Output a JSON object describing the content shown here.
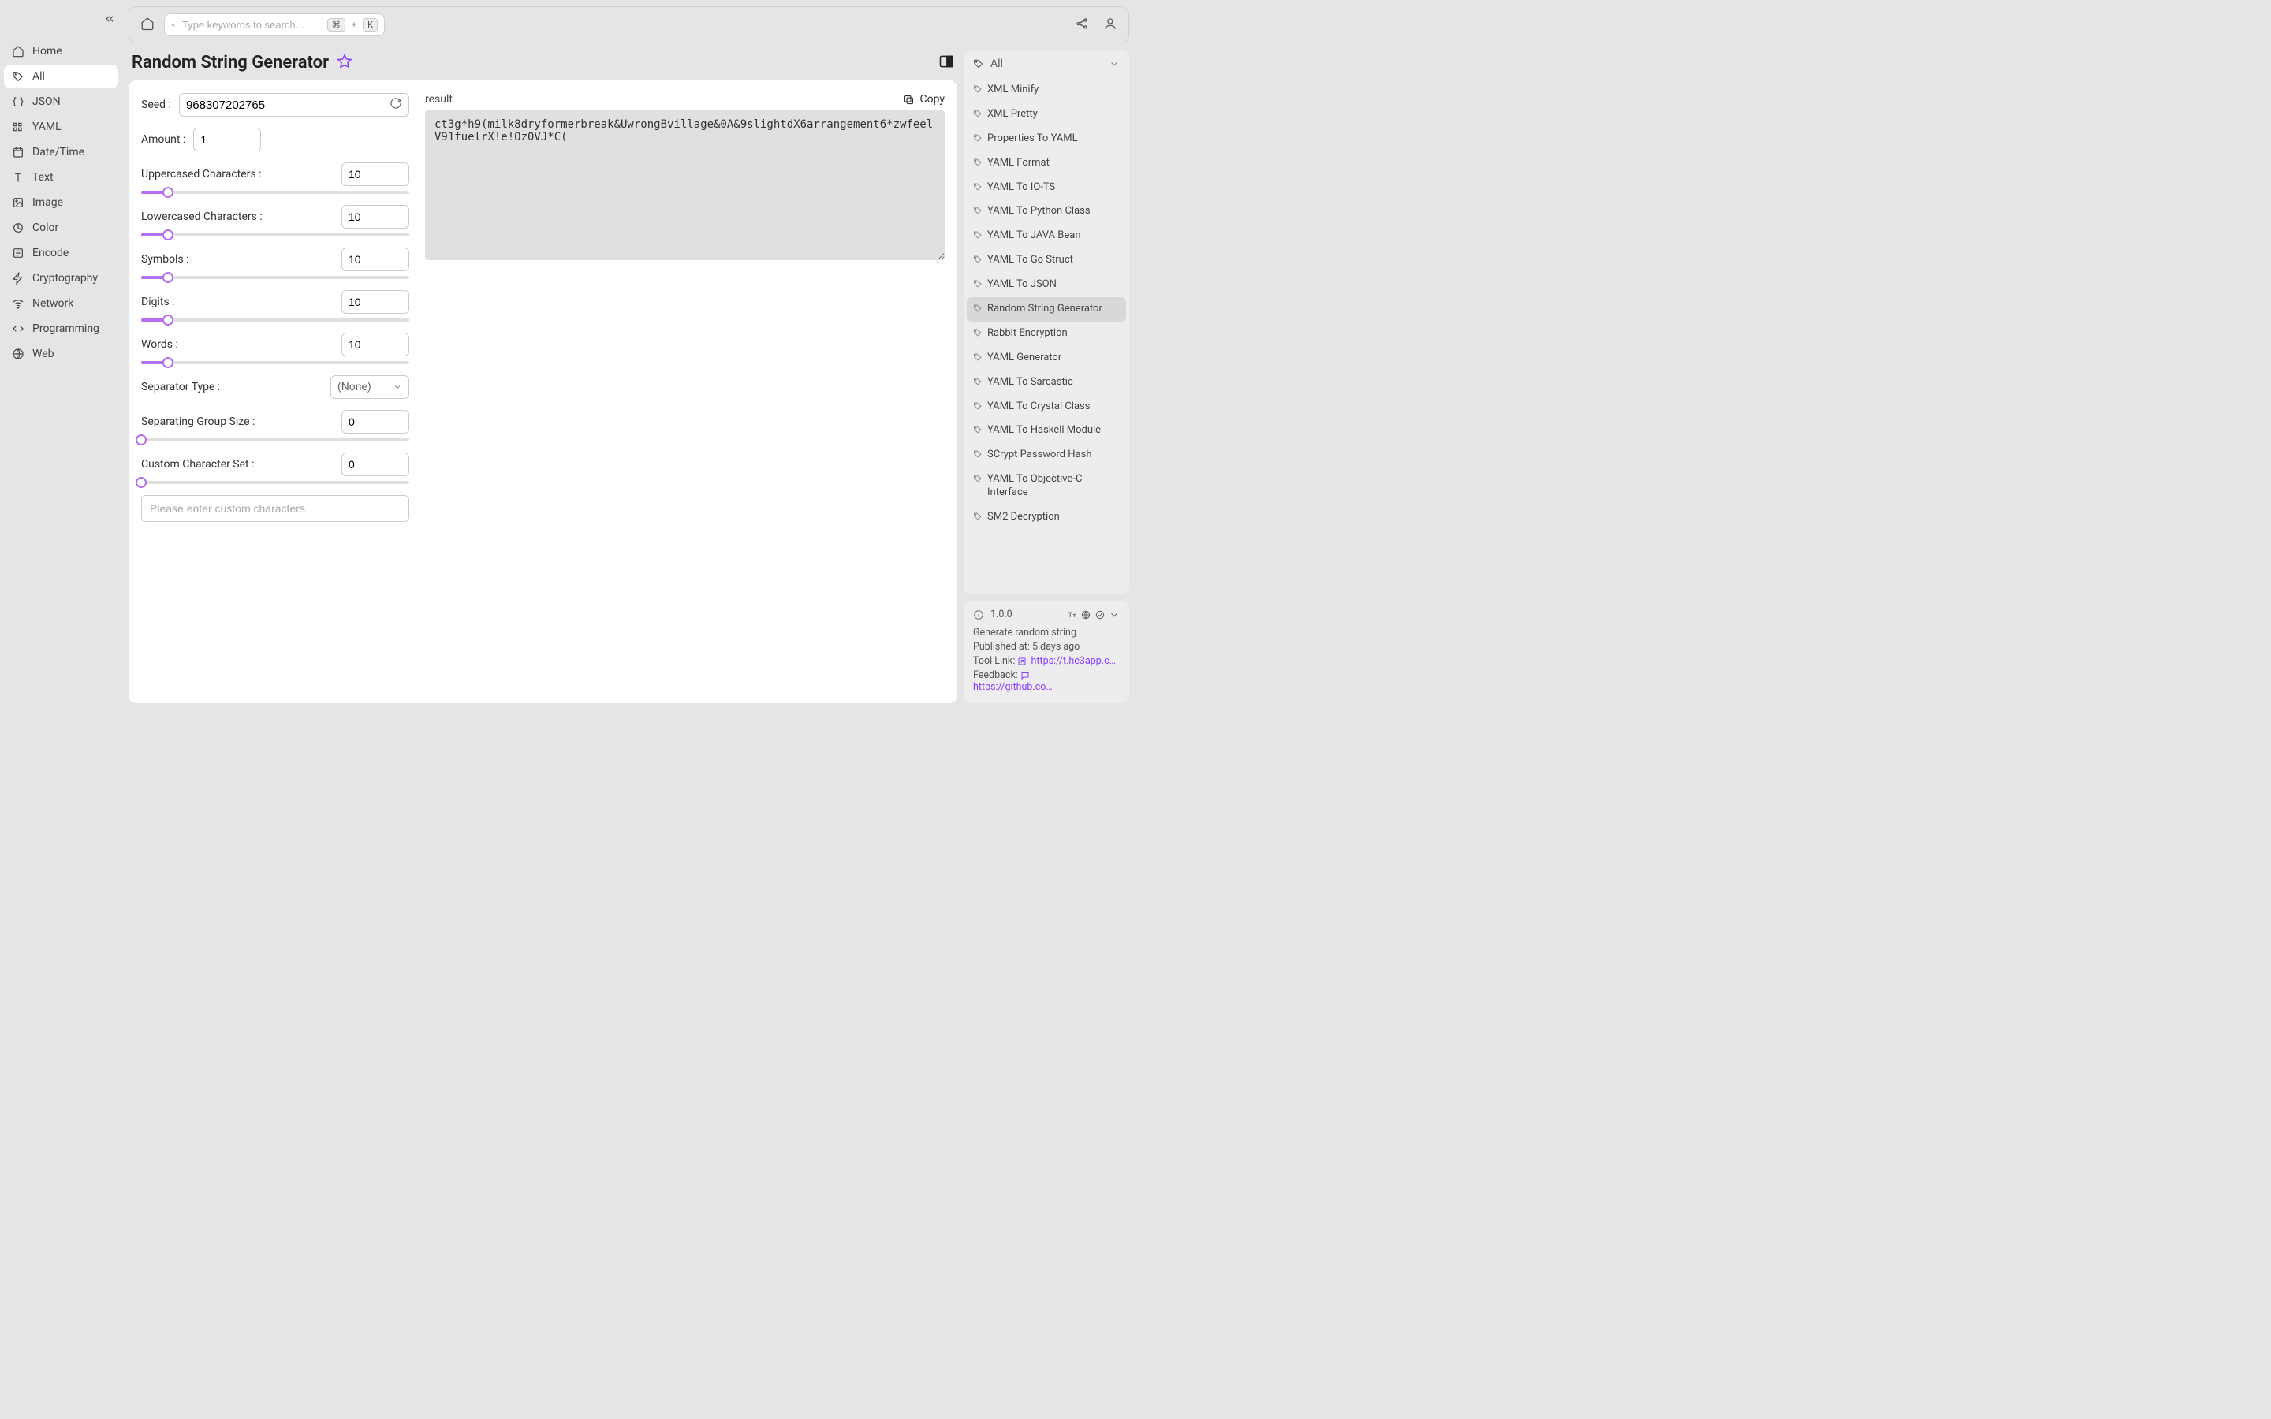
{
  "search": {
    "placeholder": "Type keywords to search...",
    "kbd1": "⌘",
    "kbd_plus": "+",
    "kbd2": "K"
  },
  "nav": {
    "items": [
      {
        "label": "Home"
      },
      {
        "label": "All"
      },
      {
        "label": "JSON"
      },
      {
        "label": "YAML"
      },
      {
        "label": "Date/Time"
      },
      {
        "label": "Text"
      },
      {
        "label": "Image"
      },
      {
        "label": "Color"
      },
      {
        "label": "Encode"
      },
      {
        "label": "Cryptography"
      },
      {
        "label": "Network"
      },
      {
        "label": "Programming"
      },
      {
        "label": "Web"
      }
    ]
  },
  "page": {
    "title": "Random String Generator"
  },
  "form": {
    "seed_label": "Seed",
    "seed_value": "968307202765",
    "amount_label": "Amount",
    "amount_value": "1",
    "upper_label": "Uppercased Characters",
    "upper_value": "10",
    "lower_label": "Lowercased Characters",
    "lower_value": "10",
    "symbols_label": "Symbols",
    "symbols_value": "10",
    "digits_label": "Digits",
    "digits_value": "10",
    "words_label": "Words",
    "words_value": "10",
    "sep_label": "Separator Type",
    "sep_value": "(None)",
    "group_label": "Separating Group Size",
    "group_value": "0",
    "custom_label": "Custom Character Set",
    "custom_value": "0",
    "custom_placeholder": "Please enter custom characters",
    "slider_pct_10": "10%",
    "slider_pct_0": "0%"
  },
  "result": {
    "label": "result",
    "copy": "Copy",
    "text": "ct3g*h9(milk8dryformerbreak&UwrongBvillage&0A&9slightdX6arrangement6*zwfeelV91fuelrX!e!Oz0VJ*C("
  },
  "right": {
    "filter": "All",
    "tools": [
      "XML Minify",
      "XML Pretty",
      "Properties To YAML",
      "YAML Format",
      "YAML To IO-TS",
      "YAML To Python Class",
      "YAML To JAVA Bean",
      "YAML To Go Struct",
      "YAML To JSON",
      "Random String Generator",
      "Rabbit Encryption",
      "YAML Generator",
      "YAML To Sarcastic",
      "YAML To Crystal Class",
      "YAML To Haskell Module",
      "SCrypt Password Hash",
      "YAML To Objective-C Interface",
      "SM2 Decryption"
    ],
    "active_index": 9
  },
  "info": {
    "version": "1.0.0",
    "description": "Generate random string",
    "published_label": "Published at:",
    "published_value": "5 days ago",
    "tool_link_label": "Tool Link:",
    "tool_link_value": "https://t.he3app.co…",
    "feedback_label": "Feedback:",
    "feedback_value": "https://github.com/…"
  }
}
